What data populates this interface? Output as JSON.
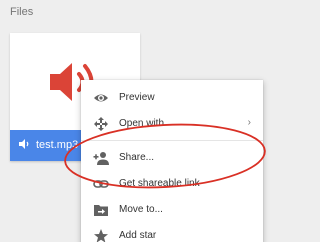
{
  "section": {
    "title": "Files"
  },
  "file": {
    "name": "test.mp3",
    "thumbnail_icon": "audio-speaker-icon",
    "type_icon": "audio-file-icon",
    "footer_color": "#4a86e8",
    "icon_color": "#db4437"
  },
  "context_menu": {
    "items": [
      {
        "label": "Preview",
        "icon": "eye-icon"
      },
      {
        "label": "Open with",
        "icon": "open-with-icon",
        "submenu_indicator": "›"
      },
      {
        "label": "Share...",
        "icon": "add-person-icon"
      },
      {
        "label": "Get shareable link",
        "icon": "link-icon"
      },
      {
        "label": "Move to...",
        "icon": "folder-move-icon"
      },
      {
        "label": "Add star",
        "icon": "star-icon"
      }
    ]
  },
  "annotation": {
    "highlight_color": "#d93025",
    "highlighted_item": "Share..."
  }
}
